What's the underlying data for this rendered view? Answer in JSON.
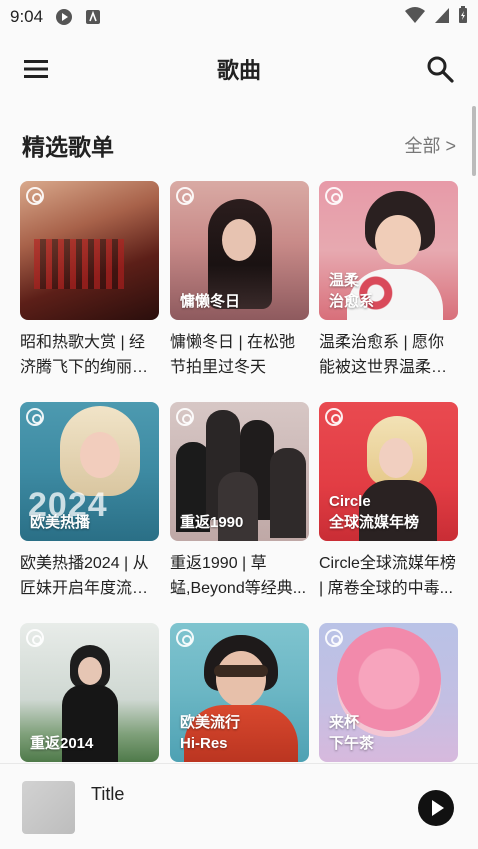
{
  "status_bar": {
    "time": "9:04"
  },
  "app_bar": {
    "title": "歌曲"
  },
  "section": {
    "title": "精选歌单",
    "see_all": "全部 >"
  },
  "playlists": [
    {
      "cover_text": "",
      "desc": "昭和热歌大赏 | 经济腾飞下的绚丽和..."
    },
    {
      "cover_text": "慵懒冬日",
      "desc": "慵懒冬日 | 在松弛节拍里过冬天"
    },
    {
      "cover_text": "温柔\n治愈系",
      "desc": "温柔治愈系 | 愿你能被这世界温柔对..."
    },
    {
      "cover_text": "欧美热播",
      "desc": "欧美热播2024 | 从匠妹开启年度流行..."
    },
    {
      "cover_text": "重返1990",
      "desc": "重返1990 | 草蜢,Beyond等经典..."
    },
    {
      "cover_text": "Circle\n全球流媒年榜",
      "desc": "Circle全球流媒年榜 | 席卷全球的中毒..."
    },
    {
      "cover_text": "重返2014",
      "desc": ""
    },
    {
      "cover_text": "欧美流行\nHi-Res",
      "desc": ""
    },
    {
      "cover_text": "来杯\n下午茶",
      "desc": ""
    }
  ],
  "cover_extra": {
    "year_2024": "2024"
  },
  "mini_player": {
    "title": "Title"
  },
  "colors": {
    "background": "#fafafa",
    "text": "#222222",
    "muted": "#777777",
    "play_button": "#111111"
  }
}
